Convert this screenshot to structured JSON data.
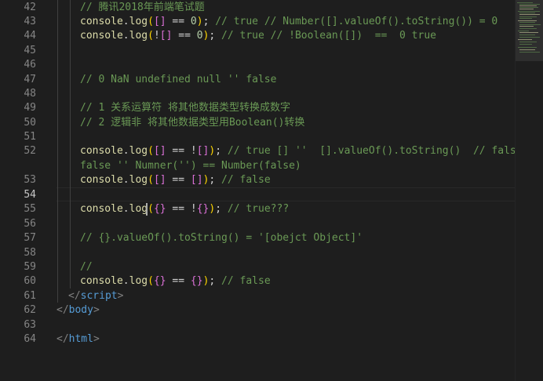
{
  "editor": {
    "line_numbers": [
      "42",
      "43",
      "44",
      "45",
      "46",
      "47",
      "48",
      "49",
      "50",
      "51",
      "52",
      "",
      "53",
      "54",
      "55",
      "56",
      "57",
      "58",
      "59",
      "60",
      "61",
      "62",
      "63",
      "64"
    ],
    "active_line": "54",
    "lines": [
      {
        "parts": [
          [
            "cm",
            "// 腾讯2018年前端笔试题"
          ]
        ]
      },
      {
        "parts": [
          [
            "fn",
            "console"
          ],
          [
            "txt",
            "."
          ],
          [
            "fn",
            "log"
          ],
          [
            "br2",
            "("
          ],
          [
            "br1",
            "[]"
          ],
          [
            "txt",
            " == "
          ],
          [
            "num",
            "0"
          ],
          [
            "br2",
            ")"
          ],
          [
            "txt",
            "; "
          ],
          [
            "cm",
            "// true // Number([].valueOf().toString()) = 0"
          ]
        ]
      },
      {
        "parts": [
          [
            "fn",
            "console"
          ],
          [
            "txt",
            "."
          ],
          [
            "fn",
            "log"
          ],
          [
            "br2",
            "("
          ],
          [
            "txt",
            "!"
          ],
          [
            "br1",
            "[]"
          ],
          [
            "txt",
            " == "
          ],
          [
            "num",
            "0"
          ],
          [
            "br2",
            ")"
          ],
          [
            "txt",
            "; "
          ],
          [
            "cm",
            "// true // !Boolean([])  ==  0 true"
          ]
        ]
      },
      {
        "parts": []
      },
      {
        "parts": []
      },
      {
        "parts": [
          [
            "cm",
            "// 0 NaN undefined null '' false"
          ]
        ]
      },
      {
        "parts": []
      },
      {
        "parts": [
          [
            "cm",
            "// 1 关系运算符 将其他数据类型转换成数字"
          ]
        ]
      },
      {
        "parts": [
          [
            "cm",
            "// 2 逻辑非 将其他数据类型用Boolean()转换"
          ]
        ]
      },
      {
        "parts": []
      },
      {
        "parts": [
          [
            "fn",
            "console"
          ],
          [
            "txt",
            "."
          ],
          [
            "fn",
            "log"
          ],
          [
            "br2",
            "("
          ],
          [
            "br1",
            "[]"
          ],
          [
            "txt",
            " == !"
          ],
          [
            "br1",
            "[]"
          ],
          [
            "br2",
            ")"
          ],
          [
            "txt",
            "; "
          ],
          [
            "cm",
            "// true [] ''  [].valueOf().toString()  // false"
          ]
        ]
      },
      {
        "parts": [
          [
            "cm",
            "false '' Numner('') == Number(false)"
          ]
        ]
      },
      {
        "parts": [
          [
            "fn",
            "console"
          ],
          [
            "txt",
            "."
          ],
          [
            "fn",
            "log"
          ],
          [
            "br2",
            "("
          ],
          [
            "br1",
            "[]"
          ],
          [
            "txt",
            " == "
          ],
          [
            "br1",
            "[]"
          ],
          [
            "br2",
            ")"
          ],
          [
            "txt",
            "; "
          ],
          [
            "cm",
            "// false"
          ]
        ]
      },
      {
        "parts": []
      },
      {
        "parts": [
          [
            "fn",
            "console"
          ],
          [
            "txt",
            "."
          ],
          [
            "fn",
            "log"
          ],
          [
            "br2",
            "("
          ],
          [
            "br1",
            "{}"
          ],
          [
            "txt",
            " == !"
          ],
          [
            "br1",
            "{}"
          ],
          [
            "br2",
            ")"
          ],
          [
            "txt",
            "; "
          ],
          [
            "cm",
            "// true???"
          ]
        ]
      },
      {
        "parts": []
      },
      {
        "parts": [
          [
            "cm",
            "// {}.valueOf().toString() = '[obejct Object]'"
          ]
        ]
      },
      {
        "parts": []
      },
      {
        "parts": [
          [
            "cm",
            "//"
          ]
        ]
      },
      {
        "parts": [
          [
            "fn",
            "console"
          ],
          [
            "txt",
            "."
          ],
          [
            "fn",
            "log"
          ],
          [
            "br2",
            "("
          ],
          [
            "br1",
            "{}"
          ],
          [
            "txt",
            " == "
          ],
          [
            "br1",
            "{}"
          ],
          [
            "br2",
            ")"
          ],
          [
            "txt",
            "; "
          ],
          [
            "cm",
            "// false"
          ]
        ]
      },
      {
        "parts": [
          [
            "punc",
            "</"
          ],
          [
            "tag",
            "script"
          ],
          [
            "punc",
            ">"
          ]
        ]
      },
      {
        "parts": [
          [
            "punc",
            "</"
          ],
          [
            "tag",
            "body"
          ],
          [
            "punc",
            ">"
          ]
        ]
      },
      {
        "parts": []
      },
      {
        "parts": [
          [
            "punc",
            "</"
          ],
          [
            "tag",
            "html"
          ],
          [
            "punc",
            ">"
          ]
        ]
      }
    ]
  },
  "colors": {
    "background": "#1e1e1e",
    "comment": "#6a9955",
    "function": "#dcdcaa",
    "number": "#b5cea8",
    "tag": "#569cd6"
  }
}
